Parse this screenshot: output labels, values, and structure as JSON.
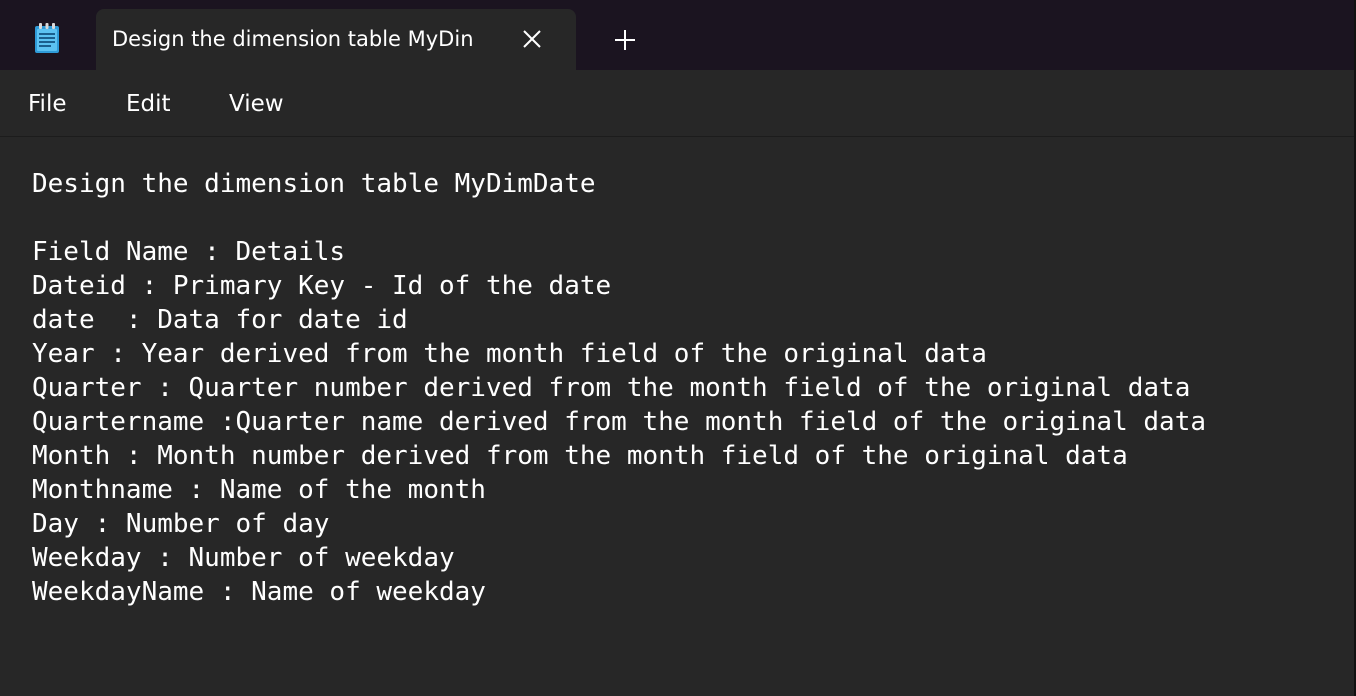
{
  "titlebar": {
    "app_icon": "notepad-icon",
    "tab_title": "Design the dimension table MyDin",
    "close_icon": "close-icon",
    "new_tab_icon": "plus-icon"
  },
  "menu": {
    "file": "File",
    "edit": "Edit",
    "view": "View"
  },
  "editor": {
    "lines": [
      "Design the dimension table MyDimDate",
      "",
      "Field Name : Details",
      "Dateid : Primary Key - Id of the date",
      "date  : Data for date id",
      "Year : Year derived from the month field of the original data",
      "Quarter : Quarter number derived from the month field of the original data",
      "Quartername :Quarter name derived from the month field of the original data",
      "Month : Month number derived from the month field of the original data",
      "Monthname : Name of the month",
      "Day : Number of day",
      "Weekday : Number of weekday",
      "WeekdayName : Name of weekday"
    ]
  },
  "colors": {
    "titlebar_bg": "#1b1420",
    "editor_bg": "#272727",
    "text": "#ffffff",
    "icon_blue": "#2f9bd8"
  }
}
